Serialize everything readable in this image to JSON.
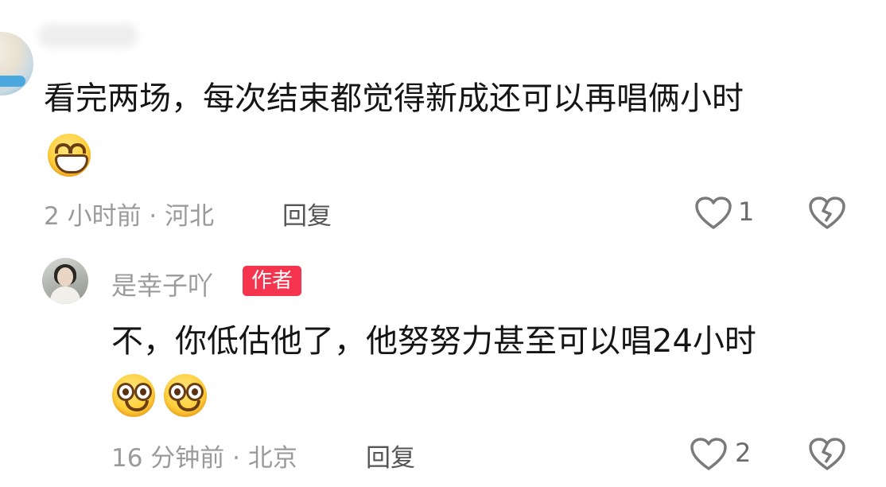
{
  "comments": [
    {
      "text": "看完两场，每次结束都觉得新成还可以再唱俩小时",
      "emojis": [
        "grinning-face-icon"
      ],
      "time_location": "2 小时前 · 河北",
      "reply_label": "回复",
      "like_count": "1"
    },
    {
      "username": "是幸子吖",
      "badge": "作者",
      "badge_color": "#f5344e",
      "text": "不，你低估他了，他努努力甚至可以唱24小时",
      "emojis": [
        "flushed-smile-icon",
        "flushed-smile-icon"
      ],
      "time_location": "16 分钟前 · 北京",
      "reply_label": "回复",
      "like_count": "2"
    }
  ]
}
